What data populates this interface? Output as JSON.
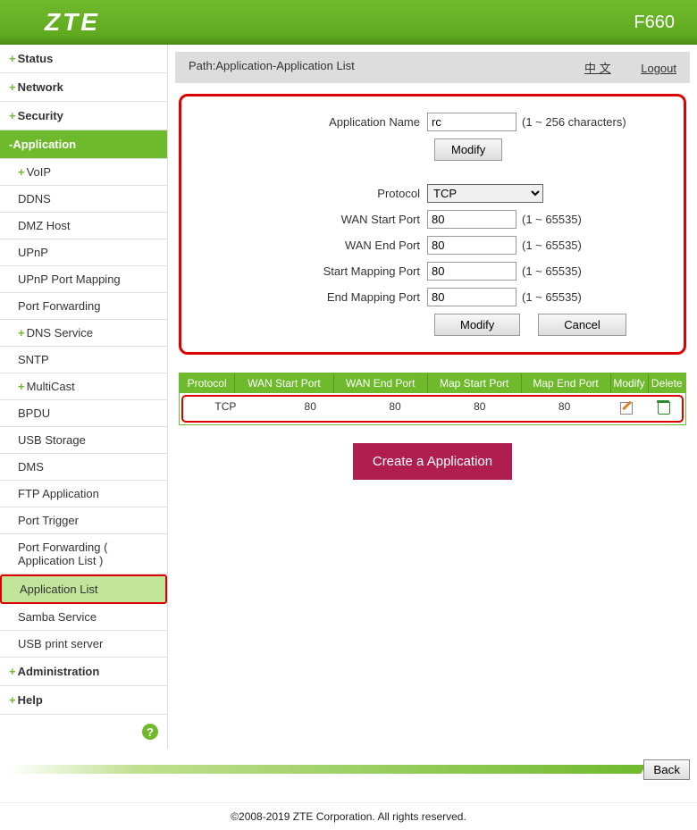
{
  "header": {
    "logo": "ZTE",
    "model": "F660"
  },
  "sidebar": {
    "cats": [
      {
        "label": "Status",
        "prefix": "+"
      },
      {
        "label": "Network",
        "prefix": "+"
      },
      {
        "label": "Security",
        "prefix": "+"
      },
      {
        "label": "Application",
        "prefix": "-",
        "active": true
      },
      {
        "label": "Administration",
        "prefix": "+"
      },
      {
        "label": "Help",
        "prefix": "+"
      }
    ],
    "subs": [
      {
        "label": "VoIP",
        "prefix": "+"
      },
      {
        "label": "DDNS",
        "prefix": ""
      },
      {
        "label": "DMZ Host",
        "prefix": ""
      },
      {
        "label": "UPnP",
        "prefix": ""
      },
      {
        "label": "UPnP Port Mapping",
        "prefix": ""
      },
      {
        "label": "Port Forwarding",
        "prefix": ""
      },
      {
        "label": "DNS Service",
        "prefix": "+"
      },
      {
        "label": "SNTP",
        "prefix": ""
      },
      {
        "label": "MultiCast",
        "prefix": "+"
      },
      {
        "label": "BPDU",
        "prefix": ""
      },
      {
        "label": "USB Storage",
        "prefix": ""
      },
      {
        "label": "DMS",
        "prefix": ""
      },
      {
        "label": "FTP Application",
        "prefix": ""
      },
      {
        "label": "Port Trigger",
        "prefix": ""
      },
      {
        "label": "Port Forwarding ( Application List )",
        "prefix": ""
      },
      {
        "label": "Application List",
        "prefix": "",
        "selected": true,
        "hl": true
      },
      {
        "label": "Samba Service",
        "prefix": ""
      },
      {
        "label": "USB print server",
        "prefix": ""
      }
    ]
  },
  "breadcrumb": {
    "path": "Path:Application-Application List",
    "lang": "中 文",
    "logout": "Logout"
  },
  "form": {
    "app_name_label": "Application Name",
    "app_name_value": "rc",
    "app_name_hint": "(1 ~ 256 characters)",
    "modify_btn": "Modify",
    "protocol_label": "Protocol",
    "protocol_value": "TCP",
    "wan_start_label": "WAN Start Port",
    "wan_start_value": "80",
    "wan_end_label": "WAN End Port",
    "wan_end_value": "80",
    "map_start_label": "Start Mapping Port",
    "map_start_value": "80",
    "map_end_label": "End Mapping Port",
    "map_end_value": "80",
    "port_hint": "(1 ~ 65535)",
    "cancel_btn": "Cancel"
  },
  "table": {
    "headers": [
      "Protocol",
      "WAN Start Port",
      "WAN End Port",
      "Map Start Port",
      "Map End Port",
      "Modify",
      "Delete"
    ],
    "row": {
      "protocol": "TCP",
      "wstart": "80",
      "wend": "80",
      "mstart": "80",
      "mend": "80"
    }
  },
  "create_btn": "Create a Application",
  "back_btn": "Back",
  "copyright": "©2008-2019 ZTE Corporation. All rights reserved."
}
